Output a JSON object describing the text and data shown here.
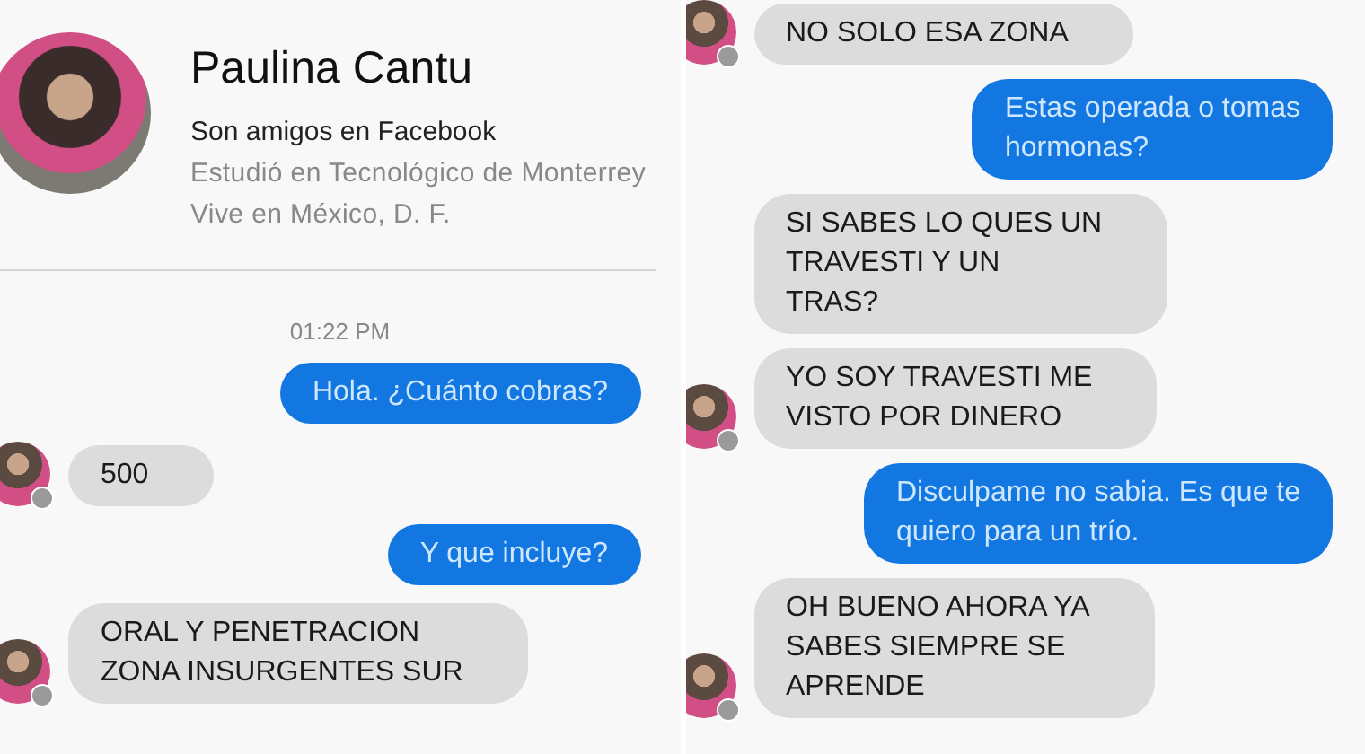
{
  "panels": [
    {
      "profile": {
        "name": "Paulina Cantu",
        "relation": "Son amigos en Facebook",
        "details": [
          "Estudió en Tecnológico de Monterrey",
          "Vive en México, D. F."
        ]
      },
      "timestamp": "01:22 PM",
      "messages": [
        {
          "kind": "outgoing",
          "text": "Hola. ¿Cuánto cobras?"
        },
        {
          "kind": "incoming",
          "text": "500",
          "avatar": true
        },
        {
          "kind": "outgoing",
          "text": "Y que incluye?"
        },
        {
          "kind": "incoming",
          "text": "ORAL Y PENETRACION\nZONA INSURGENTES SUR",
          "avatar": true
        }
      ]
    },
    {
      "messages": [
        {
          "kind": "incoming",
          "text": "NO SOLO ESA ZONA",
          "avatar": true
        },
        {
          "kind": "outgoing",
          "text": "Estas operada o tomas\nhormonas?"
        },
        {
          "kind": "incoming",
          "text": "SI SABES LO QUES UN\nTRAVESTI Y UN\nTRAS?",
          "avatar": false
        },
        {
          "kind": "incoming",
          "text": "YO SOY TRAVESTI ME\nVISTO POR DINERO",
          "avatar": true
        },
        {
          "kind": "outgoing",
          "text": "Disculpame no sabia. Es que te\nquiero para un trío."
        },
        {
          "kind": "incoming",
          "text": "OH BUENO AHORA YA\nSABES SIEMPRE SE\nAPRENDE",
          "avatar": true
        }
      ]
    }
  ]
}
